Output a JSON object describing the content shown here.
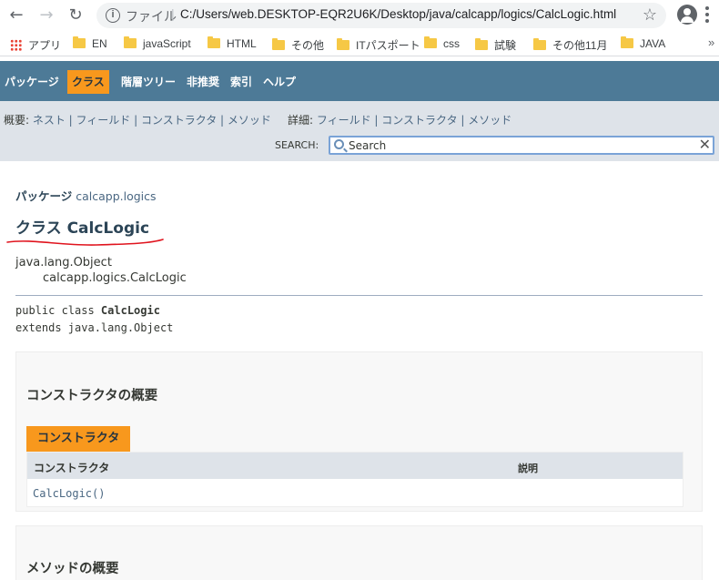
{
  "browser": {
    "omnibox_label": "ファイル",
    "url": "C:/Users/web.DESKTOP-EQR2U6K/Desktop/java/calcapp/logics/CalcLogic.html",
    "icons": [
      "back-icon",
      "forward-icon",
      "reload-icon",
      "info-icon",
      "star-icon",
      "profile-icon",
      "menu-icon"
    ]
  },
  "bookmarks": {
    "apps_label": "アプリ",
    "items": [
      "EN",
      "javaScript",
      "HTML",
      "その他",
      "ITパスポート",
      "css",
      "試験",
      "その他11月",
      "JAVA"
    ],
    "more": "»"
  },
  "topnav": {
    "items": [
      "パッケージ",
      "クラス",
      "階層ツリー",
      "非推奨",
      "索引",
      "ヘルプ"
    ],
    "active": "クラス"
  },
  "subnav": {
    "summary_prefix": "概要: ",
    "summary_items": "ネスト | フィールド | コンストラクタ | メソッド",
    "detail_prefix": "詳細: ",
    "detail_items": "フィールド | コンストラクタ | メソッド",
    "search_label": "SEARCH:",
    "search_placeholder": "Search",
    "clear": "✕"
  },
  "content": {
    "package_label": "パッケージ",
    "package_name": "calcapp.logics",
    "class_title": "クラス CalcLogic",
    "inheritance": [
      "java.lang.Object",
      "calcapp.logics.CalcLogic"
    ],
    "signature_prefix": "public class ",
    "signature_name": "CalcLogic",
    "signature_extends": "extends java.lang.Object"
  },
  "constructor_summary": {
    "heading": "コンストラクタの概要",
    "caption": "コンストラクタ",
    "col_constructor": "コンストラクタ",
    "col_description": "説明",
    "rows": [
      {
        "constructor": "CalcLogic()",
        "description": ""
      }
    ]
  },
  "method_summary": {
    "heading": "メソッドの概要"
  },
  "colors": {
    "nav_bg": "#4d7a97",
    "active_tab": "#f8981d",
    "subnav_bg": "#dee3e9",
    "annotation_red": "#e0141e"
  }
}
